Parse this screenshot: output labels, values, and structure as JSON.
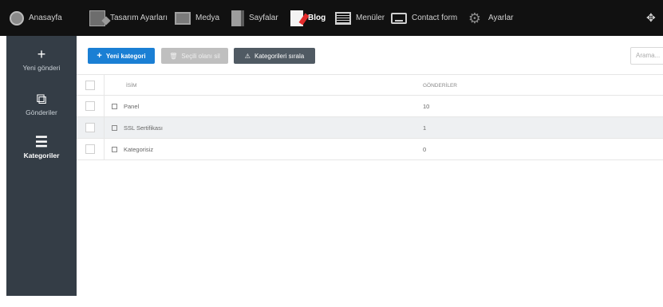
{
  "topnav": {
    "items": [
      {
        "label": "Anasayfa",
        "icon": "globe-icon"
      },
      {
        "label": "Tasarım Ayarları",
        "icon": "design-icon"
      },
      {
        "label": "Medya",
        "icon": "media-icon"
      },
      {
        "label": "Sayfalar",
        "icon": "pages-icon"
      },
      {
        "label": "Blog",
        "icon": "blog-icon"
      },
      {
        "label": "Menüler",
        "icon": "menu-icon"
      },
      {
        "label": "Contact form",
        "icon": "contact-form-icon"
      },
      {
        "label": "Ayarlar",
        "icon": "gear-icon"
      }
    ],
    "active": "Blog"
  },
  "sidebar": {
    "items": [
      {
        "label": "Yeni gönderi",
        "icon": "plus-icon"
      },
      {
        "label": "Gönderiler",
        "icon": "posts-icon"
      },
      {
        "label": "Kategoriler",
        "icon": "list-icon"
      }
    ],
    "active": "Kategoriler"
  },
  "toolbar": {
    "new_label": "Yeni kategori",
    "delete_label": "Seçili olanı sil",
    "sort_label": "Kategorileri sırala"
  },
  "search": {
    "placeholder": "Arama..."
  },
  "table": {
    "headers": {
      "name": "İSİM",
      "count": "GÖNDERİLER"
    },
    "rows": [
      {
        "name": "Panel",
        "count": "10"
      },
      {
        "name": "SSL Sertifikası",
        "count": "1"
      },
      {
        "name": "Kategorisiz",
        "count": "0"
      }
    ]
  },
  "colors": {
    "accent": "#1a7fd4",
    "topbar": "#111111",
    "sidebar": "#343d46"
  }
}
